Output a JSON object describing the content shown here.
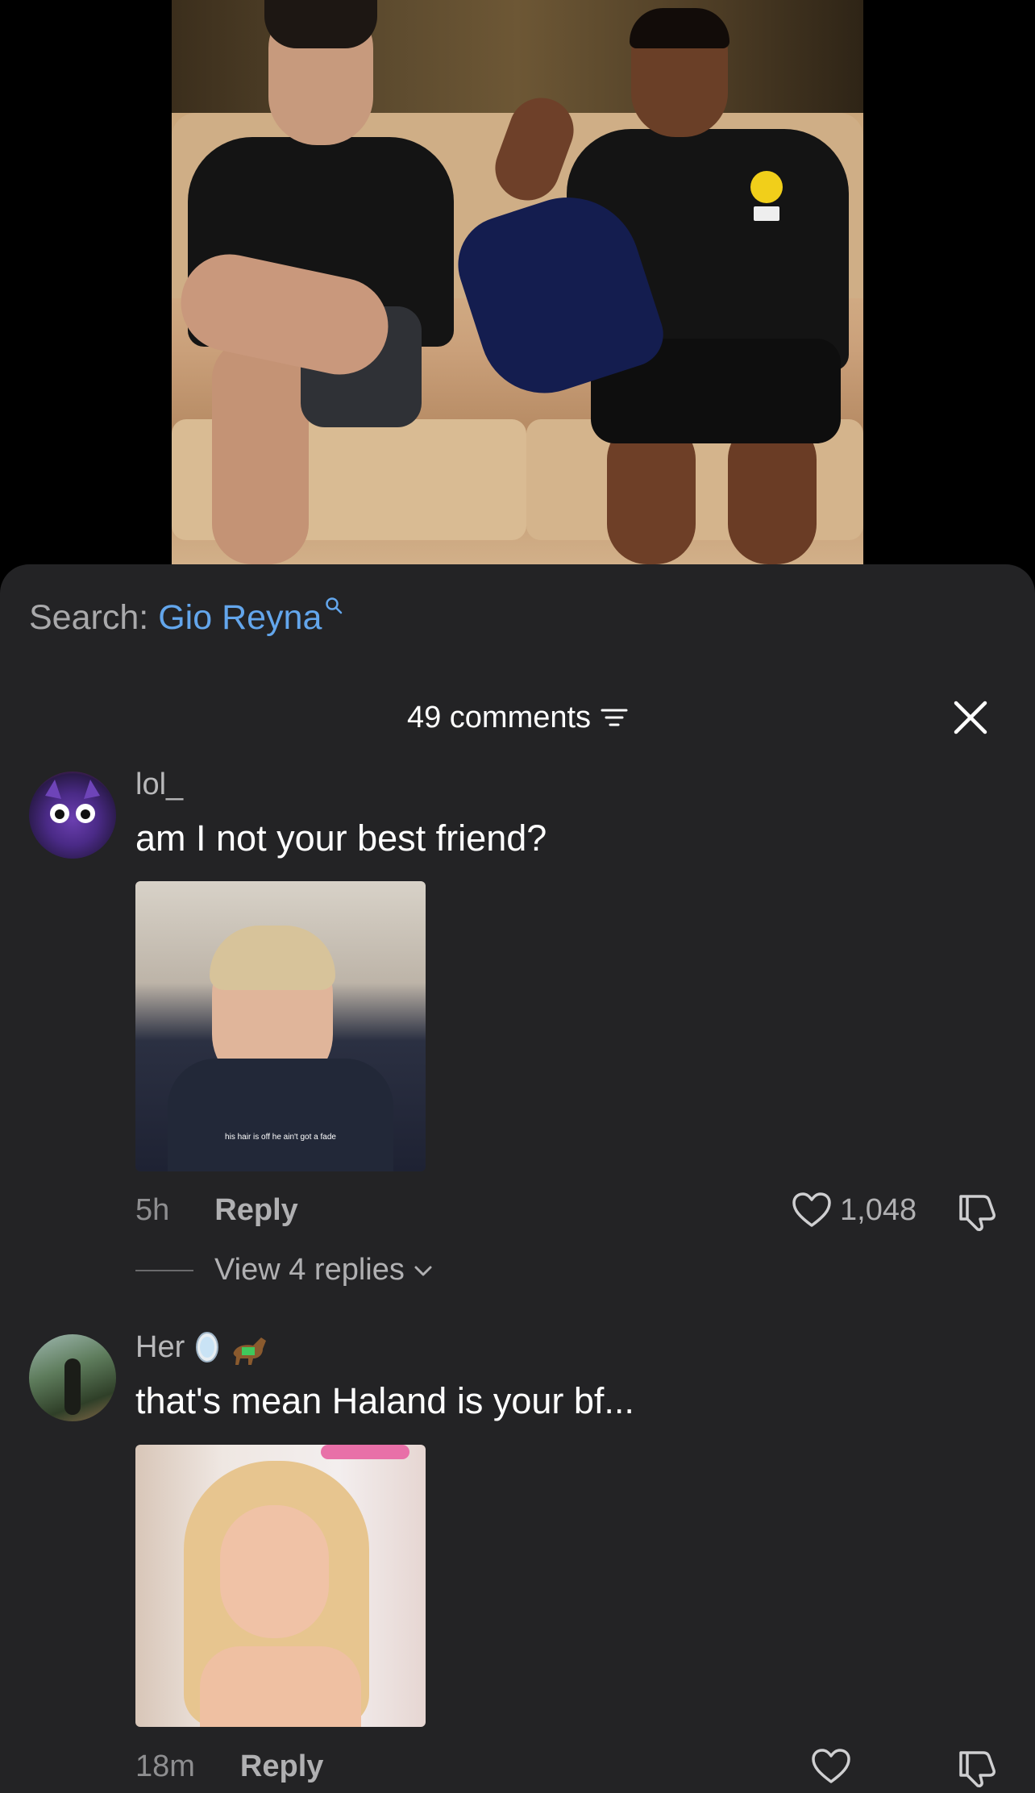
{
  "search": {
    "label": "Search:",
    "term": "Gio Reyna"
  },
  "comments_header": {
    "count_label": "49 comments"
  },
  "comments": [
    {
      "username": "lol_",
      "text": "am I not your best friend?",
      "gif_caption": "his hair is off he ain't got a fade",
      "time": "5h",
      "reply_label": "Reply",
      "likes": "1,048",
      "view_replies": "View 4 replies"
    },
    {
      "username": "Her",
      "text": "that's mean Haland is your bf...",
      "time": "18m",
      "reply_label": "Reply"
    }
  ],
  "colors": {
    "sheet_bg": "#232325",
    "accent_link": "#63a6ec",
    "muted_text": "#b0b0b2"
  }
}
